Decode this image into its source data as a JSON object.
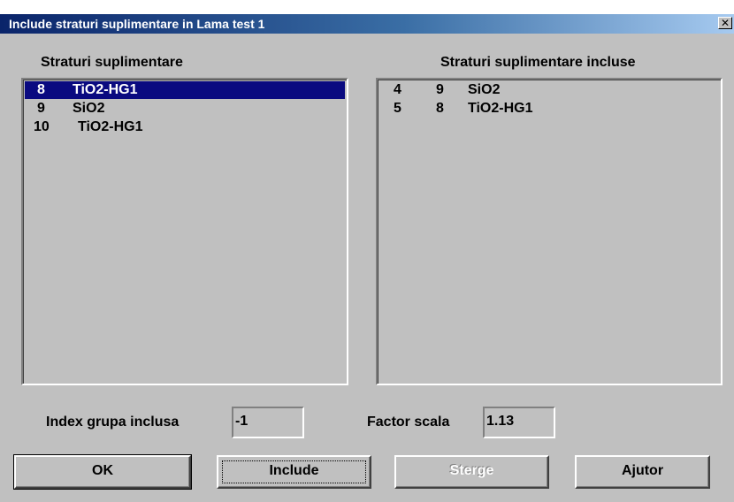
{
  "window": {
    "title": "Include straturi suplimentare in Lama test 1",
    "close_glyph": "✕"
  },
  "left_list": {
    "header": "Straturi suplimentare",
    "items": [
      {
        "index": "8",
        "name": "TiO2-HG1",
        "selected": true
      },
      {
        "index": "9",
        "name": "SiO2",
        "selected": false
      },
      {
        "index": "10",
        "name": "TiO2-HG1",
        "selected": false
      }
    ]
  },
  "right_list": {
    "header": "Straturi suplimentare incluse",
    "items": [
      {
        "pos": "4",
        "index": "9",
        "name": "SiO2"
      },
      {
        "pos": "5",
        "index": "8",
        "name": "TiO2-HG1"
      }
    ]
  },
  "fields": {
    "index_group_label": "Index grupa inclusa",
    "index_group_value": "-1",
    "scale_label": "Factor scala",
    "scale_value": "1.13"
  },
  "buttons": {
    "ok": "OK",
    "include": "Include",
    "delete": "Sterge",
    "help": "Ajutor"
  },
  "colors": {
    "selection": "#0a0a80",
    "face": "#c0c0c0"
  }
}
